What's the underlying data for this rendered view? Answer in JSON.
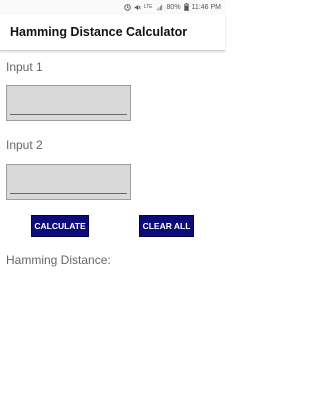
{
  "status_bar": {
    "battery": "80%",
    "time": "11:46 PM",
    "network": "LTE"
  },
  "app": {
    "title": "Hamming Distance Calculator"
  },
  "form": {
    "input1_label": "Input 1",
    "input1_value": "",
    "input2_label": "Input 2",
    "input2_value": "",
    "calculate_label": "CALCULATE",
    "clear_label": "CLEAR ALL",
    "result_label": "Hamming Distance:"
  },
  "colors": {
    "button_bg": "#0b0b7a",
    "input_bg": "#d9d9d9"
  }
}
